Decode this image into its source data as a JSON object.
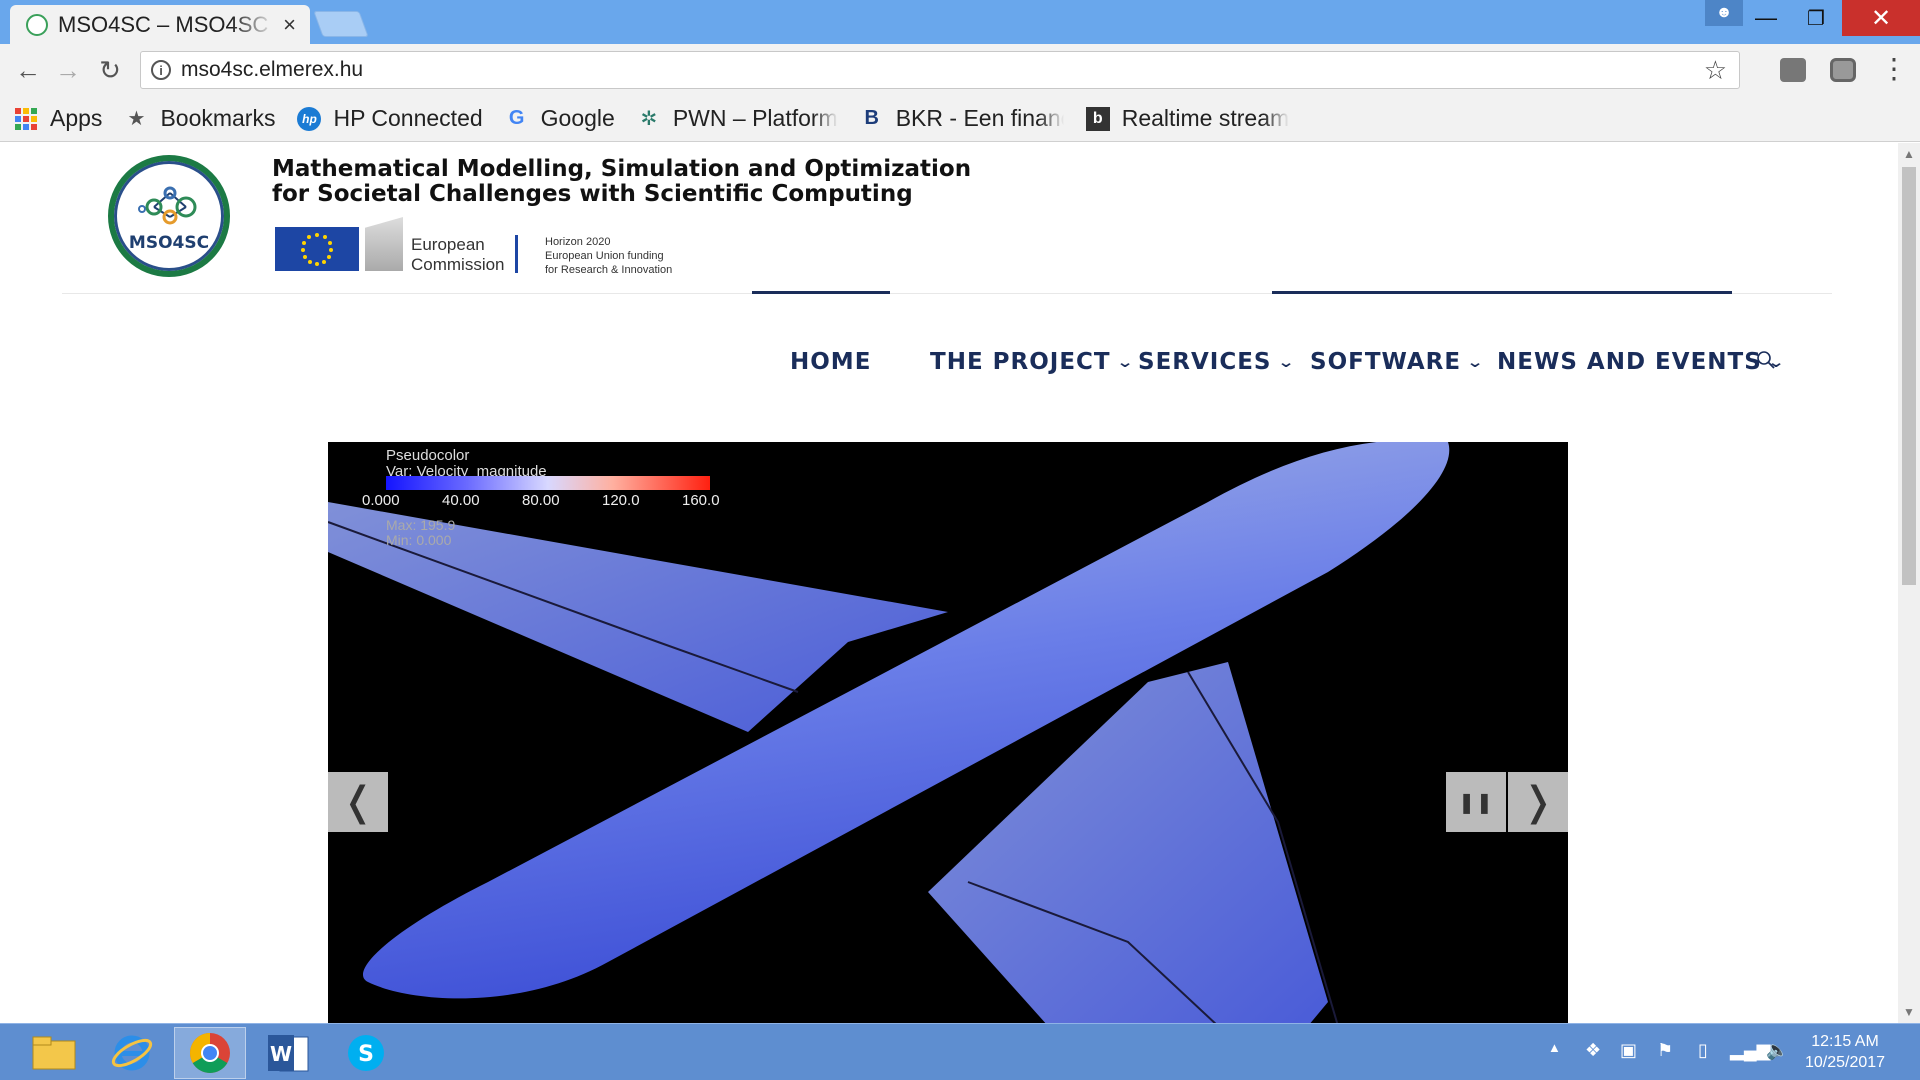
{
  "browser": {
    "tab_title": "MSO4SC – MSO4SC",
    "tab_close": "×",
    "url": "mso4sc.elmerex.hu",
    "nav": {
      "back": "←",
      "forward": "→",
      "reload": "↻"
    },
    "info_icon": "i",
    "star_icon": "☆",
    "menu_icon": "⋮",
    "window": {
      "minimize": "—",
      "maximize": "❐",
      "close": "✕"
    }
  },
  "bookmarks": [
    {
      "label": "Apps",
      "icon": "apps-grid-icon"
    },
    {
      "label": "Bookmarks",
      "icon": "star-icon",
      "glyph": "★"
    },
    {
      "label": "HP Connected",
      "icon": "hp-icon",
      "glyph": "hp"
    },
    {
      "label": "Google",
      "icon": "google-icon",
      "glyph": "G"
    },
    {
      "label": "PWN – Platform",
      "icon": "pwn-icon",
      "glyph": "✲"
    },
    {
      "label": "BKR - Een financ",
      "icon": "bkr-icon",
      "glyph": "B"
    },
    {
      "label": "Realtime stream",
      "icon": "realtime-icon",
      "glyph": "b"
    }
  ],
  "site": {
    "logo_text": "MSO4SC",
    "title_line1": "Mathematical Modelling, Simulation and Optimization",
    "title_line2": "for Societal Challenges with Scientific Computing",
    "ec_line1": "European",
    "ec_line2": "Commission",
    "h2020_line1": "Horizon 2020",
    "h2020_line2": "European Union funding",
    "h2020_line3": "for Research & Innovation"
  },
  "menu": {
    "items": [
      {
        "label": "HOME",
        "dropdown": false
      },
      {
        "label": "THE PROJECT",
        "dropdown": true
      },
      {
        "label": "SERVICES",
        "dropdown": true
      },
      {
        "label": "SOFTWARE",
        "dropdown": true
      },
      {
        "label": "NEWS AND EVENTS",
        "dropdown": true
      }
    ],
    "chevron": "⌄"
  },
  "slider": {
    "legend_title": "Pseudocolor",
    "legend_var": "Var: Velocity_magnitude",
    "ticks": [
      "0.000",
      "40.00",
      "80.00",
      "120.0",
      "160.0"
    ],
    "max": "Max: 195.9",
    "min": "Min: 0.000",
    "prev": "❬",
    "pause": "❚❚",
    "next": "❭"
  },
  "taskbar": {
    "apps": [
      "file-explorer-icon",
      "internet-explorer-icon",
      "chrome-icon",
      "word-icon",
      "skype-icon"
    ],
    "time": "12:15 AM",
    "date": "10/25/2017"
  },
  "colors": {
    "titlebar": "#69a7ec",
    "nav_text": "#1a2d5a",
    "taskbar": "#5e8ed0",
    "logo_green": "#1c7a44",
    "eu_blue": "#1d46a4"
  }
}
